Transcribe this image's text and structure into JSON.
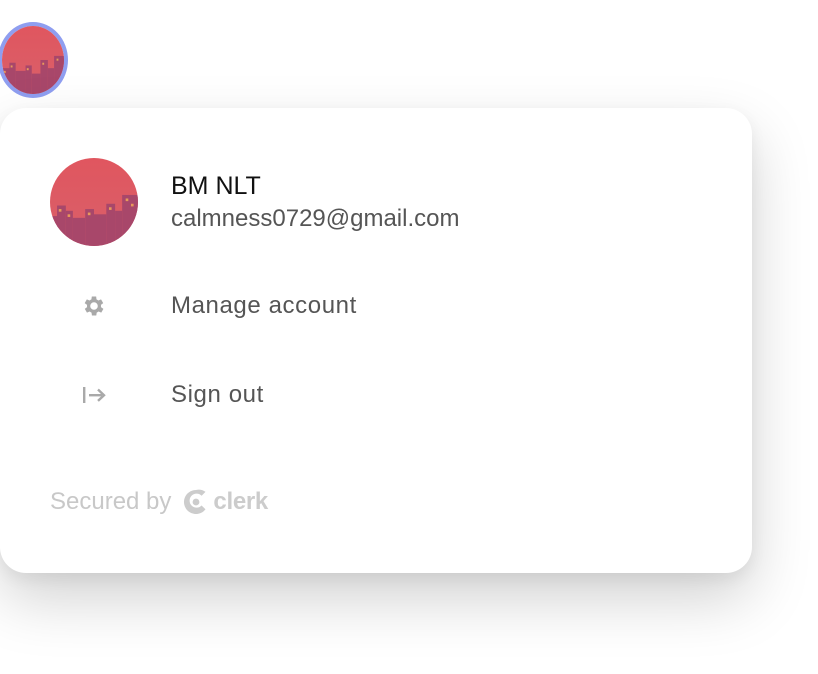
{
  "user": {
    "name": "BM NLT",
    "email": "calmness0729@gmail.com",
    "avatar_icon": "city-sunset-avatar"
  },
  "menu": {
    "items": [
      {
        "label": "Manage account",
        "icon": "gear-icon"
      },
      {
        "label": "Sign out",
        "icon": "sign-out-icon"
      }
    ]
  },
  "footer": {
    "secured_label": "Secured by",
    "brand": "clerk"
  },
  "colors": {
    "avatar_ring": "#8f9ef0",
    "avatar_top": "#e0565f",
    "avatar_bottom": "#b34a6a",
    "text_primary": "#111111",
    "text_secondary": "#555555",
    "icon_gray": "#a9a9a9",
    "footer_gray": "#c8c8c8"
  }
}
